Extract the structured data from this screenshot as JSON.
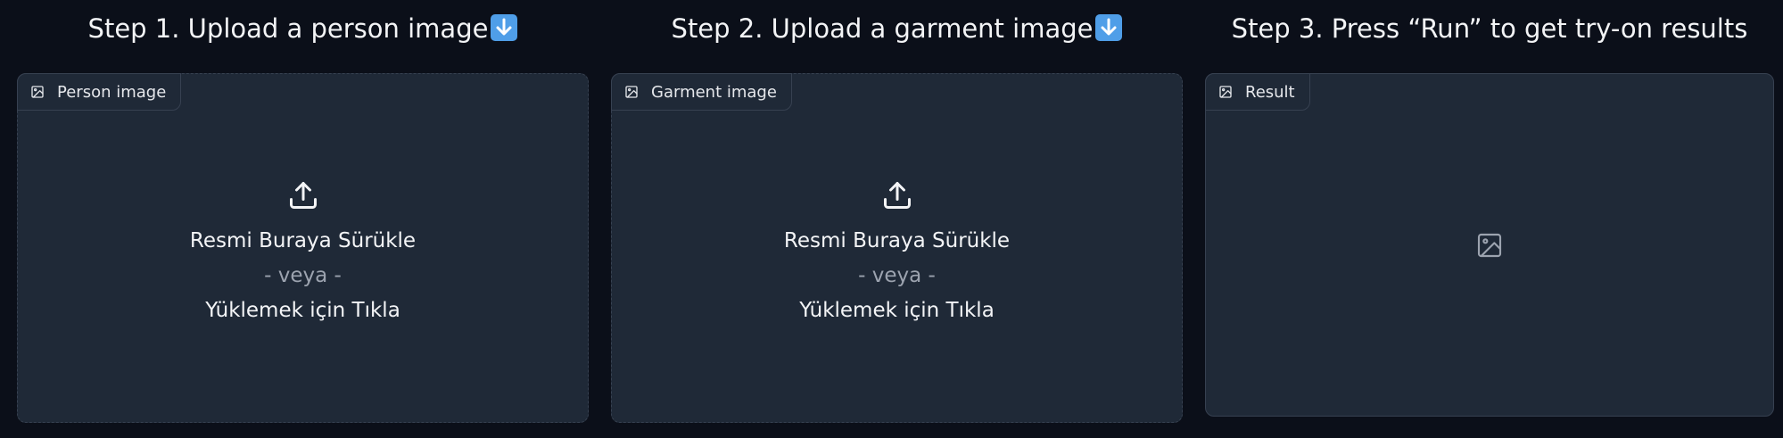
{
  "steps": [
    {
      "title": "Step 1. Upload a person image",
      "has_emoji": true,
      "emoji_icon": "down-arrow-emoji",
      "panel_label": "Person image",
      "drop_text": "Resmi Buraya Sürükle",
      "or_text": "- veya -",
      "click_text": "Yüklemek için Tıkla"
    },
    {
      "title": "Step 2. Upload a garment image",
      "has_emoji": true,
      "emoji_icon": "down-arrow-emoji",
      "panel_label": "Garment image",
      "drop_text": "Resmi Buraya Sürükle",
      "or_text": "- veya -",
      "click_text": "Yüklemek için Tıkla"
    },
    {
      "title": "Step 3. Press “Run” to get try-on results",
      "panel_label": "Result",
      "empty_icon": "image-placeholder-icon"
    }
  ],
  "colors": {
    "background": "#0b0f19",
    "panel": "#1f2937",
    "border": "#374151",
    "text": "#f3f4f6",
    "muted_text": "#9ca3af",
    "emoji": "#4f9ee8"
  }
}
